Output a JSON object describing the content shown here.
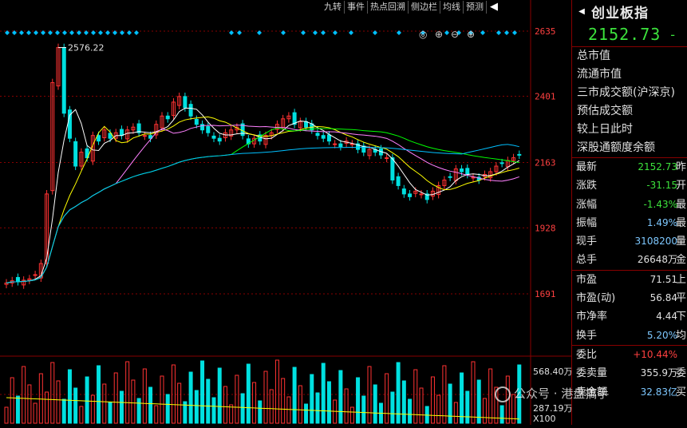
{
  "toolbar": {
    "buttons": [
      "九转",
      "事件",
      "热点回溯",
      "侧边栏",
      "均线",
      "预测"
    ]
  },
  "chart": {
    "y_labels": [
      "2635",
      "2401",
      "2163",
      "1928",
      "1691"
    ],
    "peak_label": "2576.22",
    "vol_labels": [
      "568.40万",
      "287.19万",
      "X100"
    ]
  },
  "panel": {
    "title": "创业板指",
    "price": "2152.73",
    "price_suffix": "-",
    "info_items": [
      "总市值",
      "流通市值",
      "三市成交额(沪深京)",
      "预估成交额",
      "较上日此时",
      "深股通额度余额"
    ],
    "quotes": [
      {
        "label": "最新",
        "value": "2152.73",
        "tail": "昨",
        "color": "#3ce23c"
      },
      {
        "label": "涨跌",
        "value": "-31.15",
        "tail": "开",
        "color": "#3ce23c"
      },
      {
        "label": "涨幅",
        "value": "-1.43%",
        "tail": "最",
        "color": "#3ce23c"
      },
      {
        "label": "振幅",
        "value": "1.49%",
        "tail": "最",
        "color": "#7ec8ff"
      },
      {
        "label": "现手",
        "value": "3108200",
        "tail": "量",
        "color": "#7ec8ff"
      },
      {
        "label": "总手",
        "value": "26648万",
        "tail": "金",
        "color": "#e0e0e0"
      }
    ],
    "valuation": [
      {
        "label": "市盈",
        "value": "71.51",
        "tail": "上",
        "color": "#e0e0e0"
      },
      {
        "label": "市盈(动)",
        "value": "56.84",
        "tail": "平",
        "color": "#e0e0e0"
      },
      {
        "label": "市净率",
        "value": "4.44",
        "tail": "下",
        "color": "#e0e0e0"
      },
      {
        "label": "换手",
        "value": "5.20%",
        "tail": "均",
        "color": "#7ec8ff"
      }
    ],
    "orders": [
      {
        "label": "委比",
        "value": "+10.44%",
        "tail": "",
        "color": "#ff4040"
      },
      {
        "label": "委卖量",
        "value": "355.9万",
        "tail": "委",
        "color": "#e0e0e0"
      },
      {
        "label": "卖金额",
        "value": "32.83亿",
        "tail": "买",
        "color": "#7ec8ff"
      }
    ]
  },
  "watermark": "公众号 · 港盘搞手",
  "colors": {
    "up": "#ff3232",
    "down": "#00e0e0",
    "grid": "#880000",
    "ma5": "#ffffff",
    "ma10": "#ffff00",
    "ma20": "#ff80ff",
    "ma60": "#00ff00",
    "ma120": "#00c0ff"
  }
}
